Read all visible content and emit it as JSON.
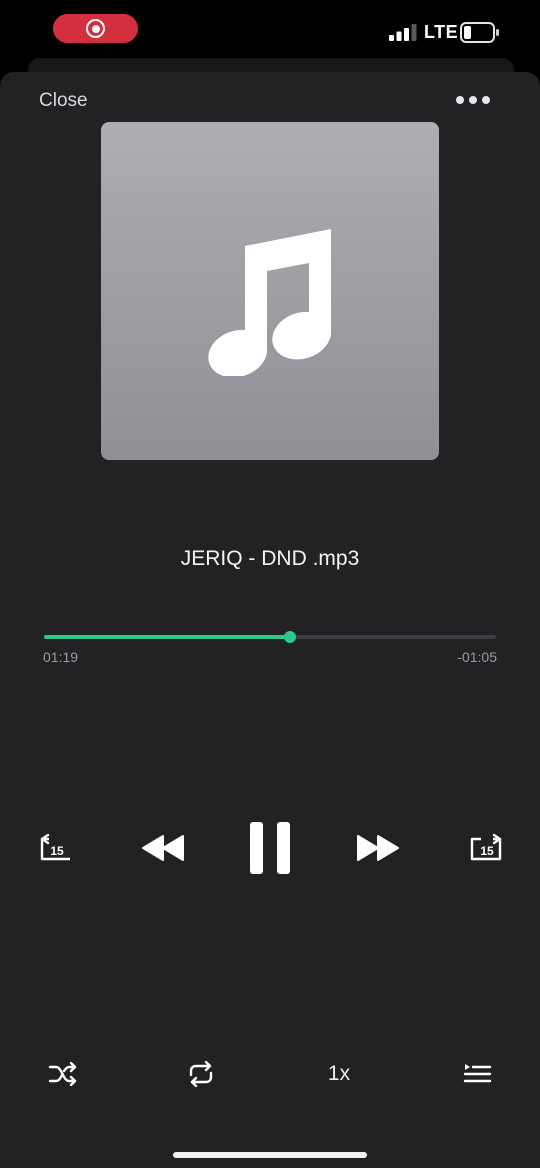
{
  "status": {
    "network": "LTE",
    "recording_color": "#d32f3f"
  },
  "header": {
    "close_label": "Close",
    "more_icon": "ellipsis-icon"
  },
  "artwork": {
    "icon": "music-note-icon"
  },
  "track": {
    "title": "JERIQ - DND .mp3"
  },
  "playback": {
    "elapsed": "01:19",
    "remaining": "-01:05",
    "progress_fraction": 0.545,
    "accent_color": "#2bc98c",
    "state": "playing"
  },
  "controls": {
    "skip_back_seconds": "15",
    "skip_forward_seconds": "15",
    "speed": "1x",
    "icons": [
      "skip-back-15-icon",
      "rewind-icon",
      "pause-icon",
      "fast-forward-icon",
      "skip-forward-15-icon",
      "shuffle-icon",
      "repeat-icon",
      "queue-list-icon"
    ]
  }
}
